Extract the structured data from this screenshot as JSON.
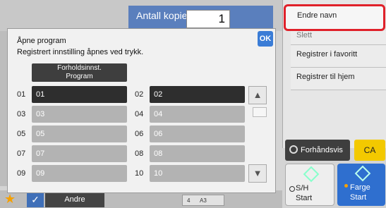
{
  "header": {
    "copies_label": "Antall kopier",
    "copies_value": "1"
  },
  "right_panel": {
    "items": [
      "Endre navn",
      "Slett",
      "Registrer i favoritt",
      "Registrer til hjem"
    ],
    "preview_label": "Forhåndsvis",
    "ca_label": "CA",
    "sh_start": [
      "S/H",
      "Start"
    ],
    "color_start": [
      "Farge",
      "Start"
    ]
  },
  "bottom": {
    "andre_label": "Andre",
    "paper_count": "4",
    "paper_size": "A3"
  },
  "dialog": {
    "title": "Åpne program",
    "subtitle": "Registrert innstilling åpnes ved trykk.",
    "condition_button": [
      "Forholdsinnst.",
      "Program"
    ],
    "ok_label": "OK",
    "programs": [
      {
        "number": "01",
        "label": "01"
      },
      {
        "number": "02",
        "label": "02"
      },
      {
        "number": "03",
        "label": "03"
      },
      {
        "number": "04",
        "label": "04"
      },
      {
        "number": "05",
        "label": "05"
      },
      {
        "number": "06",
        "label": "06"
      },
      {
        "number": "07",
        "label": "07"
      },
      {
        "number": "08",
        "label": "08"
      },
      {
        "number": "09",
        "label": "09"
      },
      {
        "number": "10",
        "label": "10"
      }
    ]
  },
  "colors": {
    "accent_blue": "#3a7cd6",
    "highlight_red": "#e0212a",
    "ca_yellow": "#f3c900"
  }
}
